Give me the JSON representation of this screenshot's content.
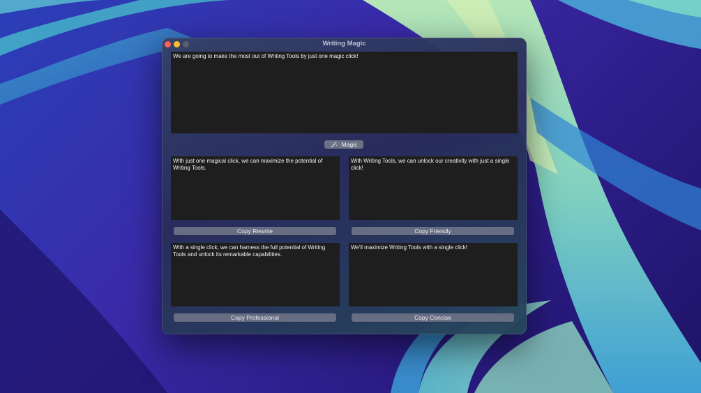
{
  "window": {
    "title": "Writing Magic"
  },
  "input": {
    "text": "We are going to make the most out of Writing Tools by just one magic click!"
  },
  "magic_button": {
    "label": "Magic",
    "icon": "magic-wand-icon"
  },
  "outputs": [
    {
      "key": "rewrite",
      "text": "With just one magical click, we can maximize the potential of Writing Tools.",
      "button_label": "Copy Rewrite"
    },
    {
      "key": "friendly",
      "text": "With Writing Tools, we can unlock our creativity with just a single click!",
      "button_label": "Copy Friendly"
    },
    {
      "key": "professional",
      "text": "With a single click, we can harness the full potential of Writing Tools and unlock its remarkable capabilities.",
      "button_label": "Copy Professional"
    },
    {
      "key": "concise",
      "text": "We'll maximize Writing Tools with a single click!",
      "button_label": "Copy Concise"
    }
  ],
  "colors": {
    "close": "#fe5f57",
    "minimize": "#febc2e",
    "zoom_inactive": "#5b5f6b",
    "textbox_bg": "#1e1e1e",
    "button_bg": "#676d82"
  }
}
